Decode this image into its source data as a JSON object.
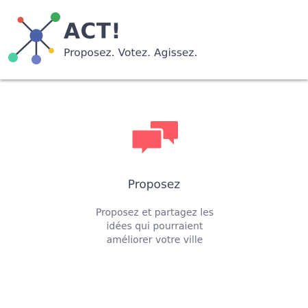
{
  "header": {
    "logo_icon": "network-nodes-logo-icon",
    "title": "ACT!",
    "tagline": "Proposez. Votez. Agissez."
  },
  "feature": {
    "icon": "chat-bubbles-icon",
    "title": "Proposez",
    "description": "Proposez et partagez les idées qui pourraient améliorer votre ville"
  },
  "colors": {
    "text_dark": "#3b4256",
    "text_muted": "#6f7383",
    "accent_coral": "#fb5a63",
    "logo_blue": "#4a63a8",
    "logo_green": "#3bab5b",
    "logo_red": "#e2574c",
    "logo_teal": "#4fd1a6",
    "logo_purple": "#6d7fc4",
    "logo_yellow": "#f2c232"
  }
}
